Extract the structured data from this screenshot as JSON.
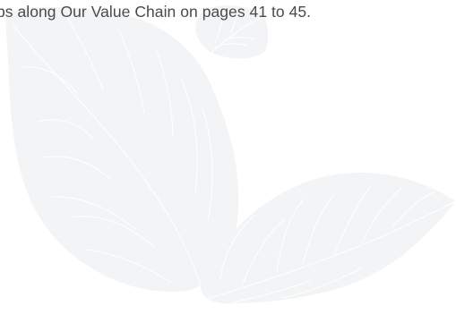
{
  "document": {
    "text_line": "ps along Our Value Chain on pages 41 to 45."
  },
  "colors": {
    "background": "#ffffff",
    "leaf": "#f3f4f6",
    "vein": "#ffffff",
    "text": "#4a4a4a"
  },
  "decorations": {
    "leaves": [
      "large-leaf-icon",
      "small-leaf-icon",
      "lower-right-leaf-icon"
    ]
  }
}
